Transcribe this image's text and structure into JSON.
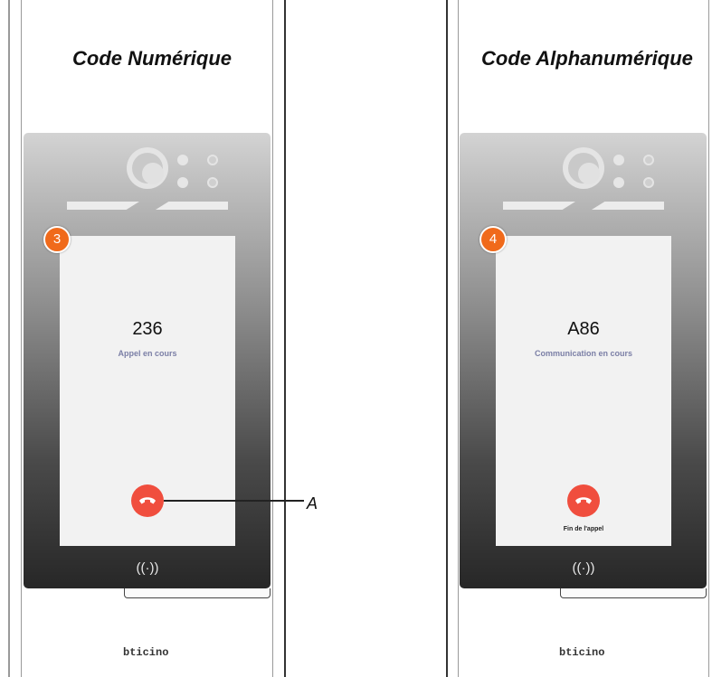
{
  "panels": [
    {
      "title": "Code Numérique",
      "step_badge": "3",
      "code": "236",
      "status": "Appel en cours",
      "hangup_label": "",
      "brand": "bticino"
    },
    {
      "title": "Code Alphanumérique",
      "step_badge": "4",
      "code": "A86",
      "status": "Communication en cours",
      "hangup_label": "Fin de l'appel",
      "brand": "bticino"
    }
  ],
  "callout": {
    "label": "A"
  },
  "icons": {
    "hangup": "phone-hangup-icon",
    "nfc": "nfc-contactless-icon",
    "camera": "camera-lens-icon"
  },
  "colors": {
    "hangup": "#f04e3e",
    "badge": "#f06a1b",
    "status_text": "#7b7fa6"
  }
}
